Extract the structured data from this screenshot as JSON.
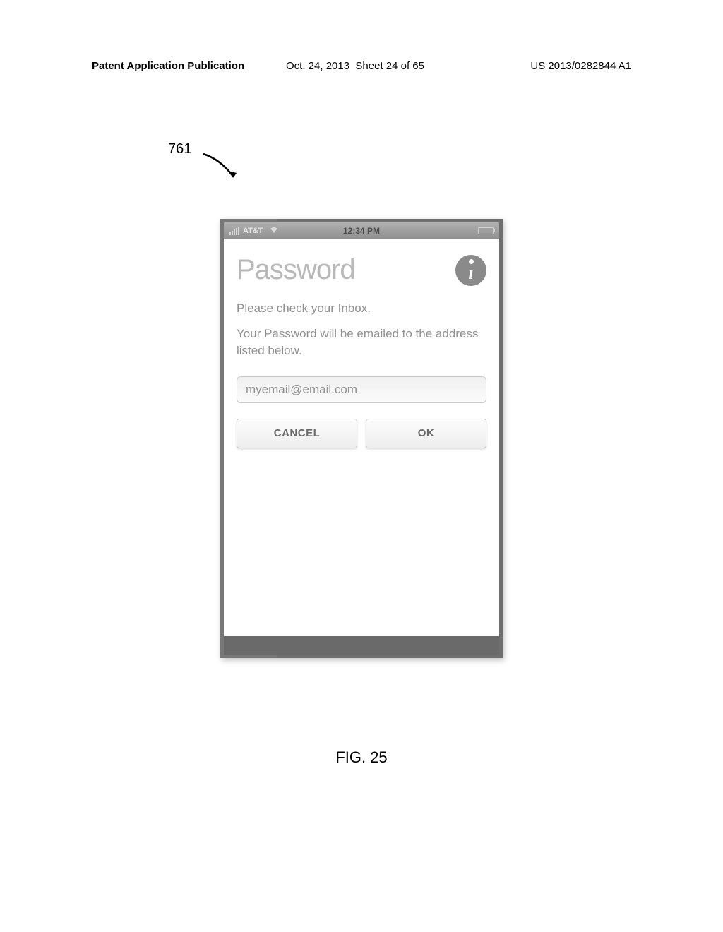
{
  "header": {
    "publication_type": "Patent Application Publication",
    "date": "Oct. 24, 2013",
    "sheet_info": "Sheet 24 of 65",
    "publication_number": "US 2013/0282844 A1"
  },
  "reference_number": "761",
  "status_bar": {
    "carrier": "AT&T",
    "time": "12:34 PM"
  },
  "screen": {
    "title": "Password",
    "instruction_1": "Please check your Inbox.",
    "instruction_2": "Your Password will be emailed to the address listed below.",
    "email_value": "myemail@email.com",
    "cancel_label": "CANCEL",
    "ok_label": "OK"
  },
  "figure_label": "FIG. 25"
}
